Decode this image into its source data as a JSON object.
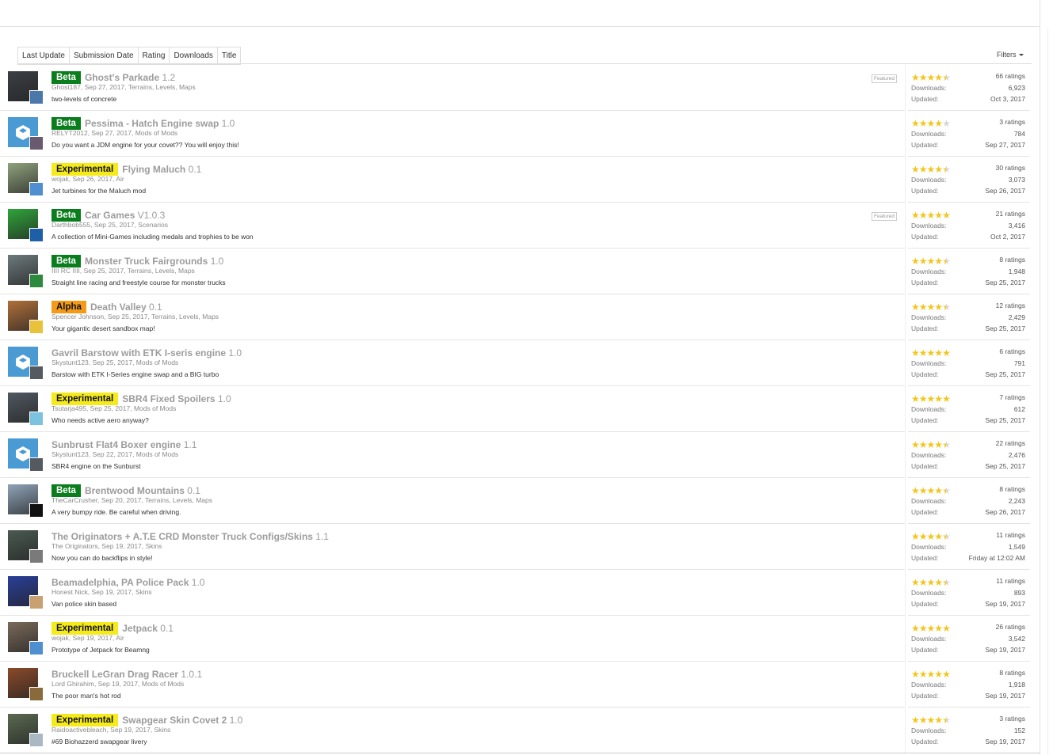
{
  "tabs": [
    "Last Update",
    "Submission Date",
    "Rating",
    "Downloads",
    "Title"
  ],
  "filters_label": "Filters",
  "labels": {
    "downloads": "Downloads:",
    "updated": "Updated:",
    "featured": "Featured"
  },
  "resources": [
    {
      "badge": "Beta",
      "title": "Ghost's Parkade",
      "version": "1.2",
      "meta": "Ghost187, Sep 27, 2017, Terrains, Levels, Maps",
      "desc": "two-levels of concrete",
      "featured": true,
      "rating": 4.5,
      "ratings": "66 ratings",
      "downloads": "6,923",
      "updated": "Oct 3, 2017",
      "thumb": "#3b3f44",
      "avatar": "#4a78a8"
    },
    {
      "badge": "Beta",
      "title": "Pessima - Hatch Engine swap",
      "version": "1.0",
      "meta": "RELYT2012, Sep 27, 2017, Mods of Mods",
      "desc": "Do you want a JDM engine for your covet?? You will enjoy this!",
      "featured": false,
      "rating": 4,
      "ratings": "3 ratings",
      "downloads": "784",
      "updated": "Sep 27, 2017",
      "thumb": "cube",
      "avatar": "#6a5a70"
    },
    {
      "badge": "Experimental",
      "title": "Flying Maluch",
      "version": "0.1",
      "meta": "wojak, Sep 26, 2017, Air",
      "desc": "Jet turbines for the Maluch mod",
      "featured": false,
      "rating": 4.5,
      "ratings": "30 ratings",
      "downloads": "3,073",
      "updated": "Sep 26, 2017",
      "thumb": "#8fa27c",
      "avatar": "#4f8fd0"
    },
    {
      "badge": "Beta",
      "title": "Car Games",
      "version": "V1.0.3",
      "meta": "Darthbob555, Sep 25, 2017, Scenarios",
      "desc": "A collection of Mini-Games including medals and trophies to be won",
      "featured": true,
      "rating": 5,
      "ratings": "21 ratings",
      "downloads": "3,416",
      "updated": "Oct 2, 2017",
      "thumb": "#2fa43a",
      "avatar": "#1f5fa8"
    },
    {
      "badge": "Beta",
      "title": "Monster Truck Fairgrounds",
      "version": "1.0",
      "meta": "IIII RC IIII, Sep 25, 2017, Terrains, Levels, Maps",
      "desc": "Straight line racing and freestyle course for monster trucks",
      "featured": false,
      "rating": 4.5,
      "ratings": "8 ratings",
      "downloads": "1,948",
      "updated": "Sep 25, 2017",
      "thumb": "#6d7a7c",
      "avatar": "#2b8a3e"
    },
    {
      "badge": "Alpha",
      "title": "Death Valley",
      "version": "0.1",
      "meta": "Spencer Johnson, Sep 25, 2017, Terrains, Levels, Maps",
      "desc": "Your gigantic desert sandbox map!",
      "featured": false,
      "rating": 4.5,
      "ratings": "12 ratings",
      "downloads": "2,429",
      "updated": "Sep 25, 2017",
      "thumb": "#b0703a",
      "avatar": "#e8c23a"
    },
    {
      "badge": "",
      "title": "Gavril Barstow with ETK I-seris engine",
      "version": "1.0",
      "meta": "Skystunt123, Sep 25, 2017, Mods of Mods",
      "desc": "Barstow with ETK I-Series engine swap and a BIG turbo",
      "featured": false,
      "rating": 5,
      "ratings": "6 ratings",
      "downloads": "791",
      "updated": "Sep 25, 2017",
      "thumb": "cube",
      "avatar": "#555a60"
    },
    {
      "badge": "Experimental",
      "title": "SBR4 Fixed Spoilers",
      "version": "1.0",
      "meta": "Tsutarja495, Sep 25, 2017, Mods of Mods",
      "desc": "Who needs active aero anyway?",
      "featured": false,
      "rating": 5,
      "ratings": "7 ratings",
      "downloads": "612",
      "updated": "Sep 25, 2017",
      "thumb": "#505860",
      "avatar": "#7cc3e0"
    },
    {
      "badge": "",
      "title": "Sunbrust Flat4 Boxer engine",
      "version": "1.1",
      "meta": "Skystunt123, Sep 22, 2017, Mods of Mods",
      "desc": "SBR4 engine on the Sunburst",
      "featured": false,
      "rating": 4.5,
      "ratings": "22 ratings",
      "downloads": "2,476",
      "updated": "Sep 25, 2017",
      "thumb": "cube",
      "avatar": "#555a60"
    },
    {
      "badge": "Beta",
      "title": "Brentwood Mountains",
      "version": "0.1",
      "meta": "TheCarCrusher, Sep 20, 2017, Terrains, Levels, Maps",
      "desc": "A very bumpy ride. Be careful when driving.",
      "featured": false,
      "rating": 4.5,
      "ratings": "8 ratings",
      "downloads": "2,243",
      "updated": "Sep 26, 2017",
      "thumb": "#8fa4b8",
      "avatar": "#111111"
    },
    {
      "badge": "",
      "title": "The Originators + A.T.E CRD Monster Truck Configs/Skins",
      "version": "1.1",
      "meta": "The Originators, Sep 19, 2017, Skins",
      "desc": "Now you can do backflips in style!",
      "featured": false,
      "rating": 4.5,
      "ratings": "11 ratings",
      "downloads": "1,549",
      "updated": "Friday at 12:02 AM",
      "thumb": "#4a5a52",
      "avatar": "#7a7a7a"
    },
    {
      "badge": "",
      "title": "Beamadelphia, PA Police Pack",
      "version": "1.0",
      "meta": "Honest Nick, Sep 19, 2017, Skins",
      "desc": "Van police skin based",
      "featured": false,
      "rating": 4.5,
      "ratings": "11 ratings",
      "downloads": "893",
      "updated": "Sep 19, 2017",
      "thumb": "#2a3f9a",
      "avatar": "#c9a070"
    },
    {
      "badge": "Experimental",
      "title": "Jetpack",
      "version": "0.1",
      "meta": "wojak, Sep 19, 2017, Air",
      "desc": "Prototype of Jetpack for Beamng",
      "featured": false,
      "rating": 5,
      "ratings": "26 ratings",
      "downloads": "3,542",
      "updated": "Sep 19, 2017",
      "thumb": "#7a6a5a",
      "avatar": "#4f8fd0"
    },
    {
      "badge": "",
      "title": "Bruckell LeGran Drag Racer",
      "version": "1.0.1",
      "meta": "Lord Ghirahim, Sep 19, 2017, Mods of Mods",
      "desc": "The poor man's hot rod",
      "featured": false,
      "rating": 5,
      "ratings": "8 ratings",
      "downloads": "1,918",
      "updated": "Sep 19, 2017",
      "thumb": "#8a4a2a",
      "avatar": "#8a6a3a"
    },
    {
      "badge": "Experimental",
      "title": "Swapgear Skin Covet 2",
      "version": "1.0",
      "meta": "Raidoactivebleach, Sep 19, 2017, Skins",
      "desc": "#69 Biohazzerd swapgear livery",
      "featured": false,
      "rating": 4.5,
      "ratings": "3 ratings",
      "downloads": "152",
      "updated": "Sep 19, 2017",
      "thumb": "#5a6a50",
      "avatar": "#aab8c4"
    }
  ]
}
